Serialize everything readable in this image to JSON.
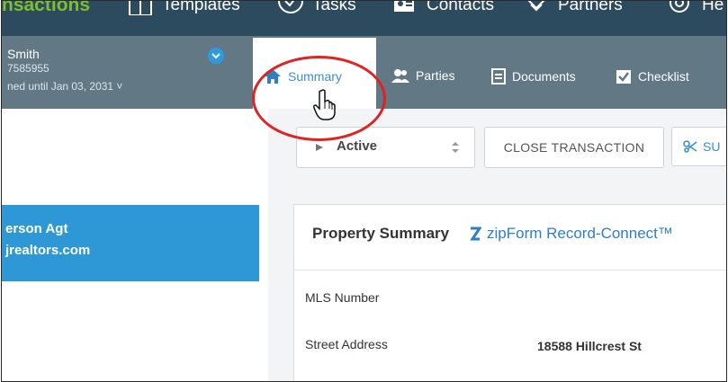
{
  "topbar": {
    "brand": "nsactions",
    "items": [
      {
        "label": "Templates",
        "icon": "templates-icon"
      },
      {
        "label": "Tasks",
        "icon": "tasks-icon"
      },
      {
        "label": "Contacts",
        "icon": "contacts-icon"
      },
      {
        "label": "Partners",
        "icon": "partners-icon"
      },
      {
        "label": "He",
        "icon": "help-icon"
      }
    ]
  },
  "user": {
    "name": "Smith",
    "phone": "7585955",
    "status": "ned until Jan 03, 2031 ˅"
  },
  "tabs": [
    {
      "label": "Summary",
      "icon": "home-icon",
      "active": true
    },
    {
      "label": "Parties",
      "icon": "parties-icon"
    },
    {
      "label": "Documents",
      "icon": "document-icon"
    },
    {
      "label": "Checklist",
      "icon": "checklist-icon"
    }
  ],
  "agent": {
    "name": "erson Agt",
    "email": "jrealtors.com"
  },
  "actions": {
    "status_value": "Active",
    "close_label": "CLOSE TRANSACTION",
    "submit_label": "SU"
  },
  "property": {
    "title": "Property Summary",
    "link": "zipForm Record-Connect™",
    "fields": [
      {
        "label": "MLS Number",
        "value": ""
      },
      {
        "label": "Street Address",
        "value": "18588 Hillcrest St"
      }
    ]
  },
  "colors": {
    "topbar": "#2d4b5e",
    "subbar": "#627884",
    "brand": "#7ebd2f",
    "accent": "#2e97d6",
    "annotation": "#e02222"
  }
}
